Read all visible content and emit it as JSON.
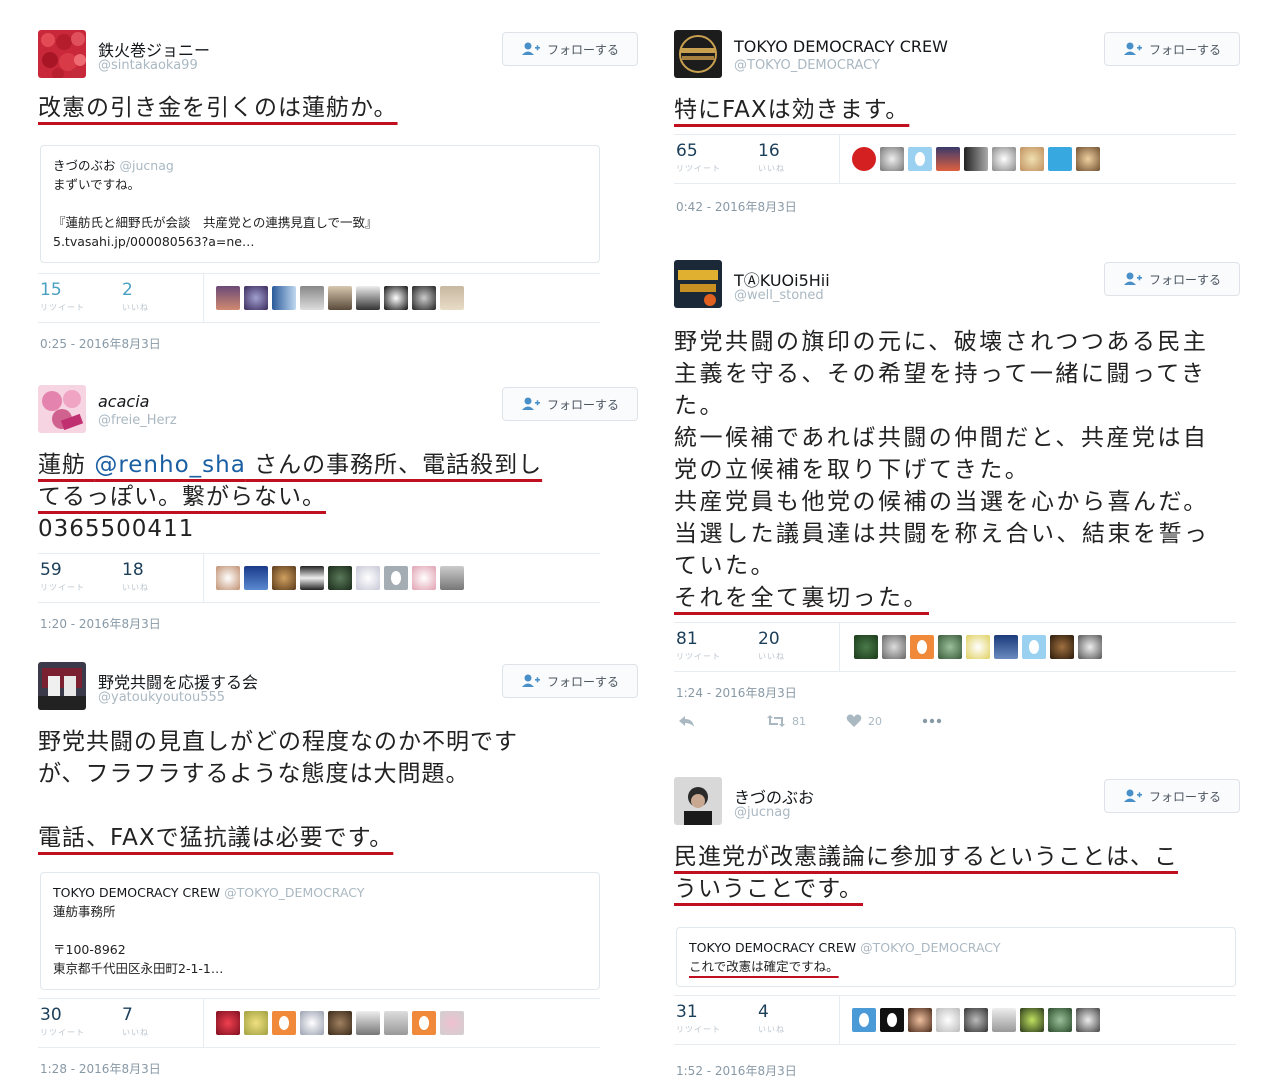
{
  "follow_label": "フォローする",
  "retweet_label": "リツイート",
  "like_label": "いいね",
  "colors": {
    "underline": "#c00f1e",
    "count": "#1b3e59",
    "mention": "#1b5fa3",
    "muted": "#aab8c2"
  },
  "left": [
    {
      "name": "鉄火巻ジョニー",
      "handle": "@sintakaoka99",
      "body": "改憲の引き金を引くのは蓮舫か。",
      "quote": {
        "name": "きづのぶお",
        "handle": "@jucnag",
        "l1": "まずいですね。",
        "l2": "『蓮舫氏と細野氏が会談　共産党との連携見直しで一致』",
        "l3": "5.tvasahi.jp/000080563?a=ne…"
      },
      "retweets": "15",
      "likes": "2",
      "date": "0:25 - 2016年8月3日"
    },
    {
      "name": "acacia",
      "handle": "@freie_Herz",
      "body_a": "蓮舫 ",
      "mention": "@renho_sha",
      "body_b": " さんの事務所、電話殺到し",
      "body_c": "てるっぽい。繋がらない。",
      "body_d": "0365500411",
      "retweets": "59",
      "likes": "18",
      "date": "1:20 - 2016年8月3日"
    },
    {
      "name": "野党共闘を応援する会",
      "handle": "@yatoukyoutou555",
      "body_a": "野党共闘の見直しがどの程度なのか不明です",
      "body_b": "が、フラフラするような態度は大問題。",
      "body_c": "電話、FAXで猛抗議は必要です。",
      "quote": {
        "name": "TOKYO DEMOCRACY CREW",
        "handle": "@TOKYO_DEMOCRACY",
        "l1": "蓮舫事務所",
        "l2": "〒100-8962",
        "l3": "東京都千代田区永田町2-1-1…"
      },
      "retweets": "30",
      "likes": "7",
      "date": "1:28 - 2016年8月3日"
    }
  ],
  "right": [
    {
      "name": "TOKYO DEMOCRACY CREW",
      "handle": "@TOKYO_DEMOCRACY",
      "body": "特にFAXは効きます。",
      "retweets": "65",
      "likes": "16",
      "date": "0:42 - 2016年8月3日"
    },
    {
      "name": "TⒶKUOi5Hii",
      "handle": "@well_stoned",
      "lines": [
        "野党共闘の旗印の元に、破壊されつつある民主",
        "主義を守る、その希望を持って一緒に闘ってき",
        "た。",
        "統一候補であれば共闘の仲間だと、共産党は自",
        "党の立候補を取り下げてきた。",
        "共産党員も他党の候補の当選を心から喜んだ。",
        "当選した議員達は共闘を称え合い、結束を誓っ",
        "ていた。",
        "それを全て裏切った。"
      ],
      "retweets": "81",
      "likes": "20",
      "date": "1:24 - 2016年8月3日",
      "action_retweets": "81",
      "action_likes": "20"
    },
    {
      "name": "きづのぶお",
      "handle": "@jucnag",
      "body_a": "民進党が改憲議論に参加するということは、こ",
      "body_b": "ういうことです。",
      "quote": {
        "name": "TOKYO DEMOCRACY CREW",
        "handle": "@TOKYO_DEMOCRACY",
        "l1": "これで改憲は確定ですね。"
      },
      "retweets": "31",
      "likes": "4",
      "date": "1:52 - 2016年8月3日"
    }
  ]
}
